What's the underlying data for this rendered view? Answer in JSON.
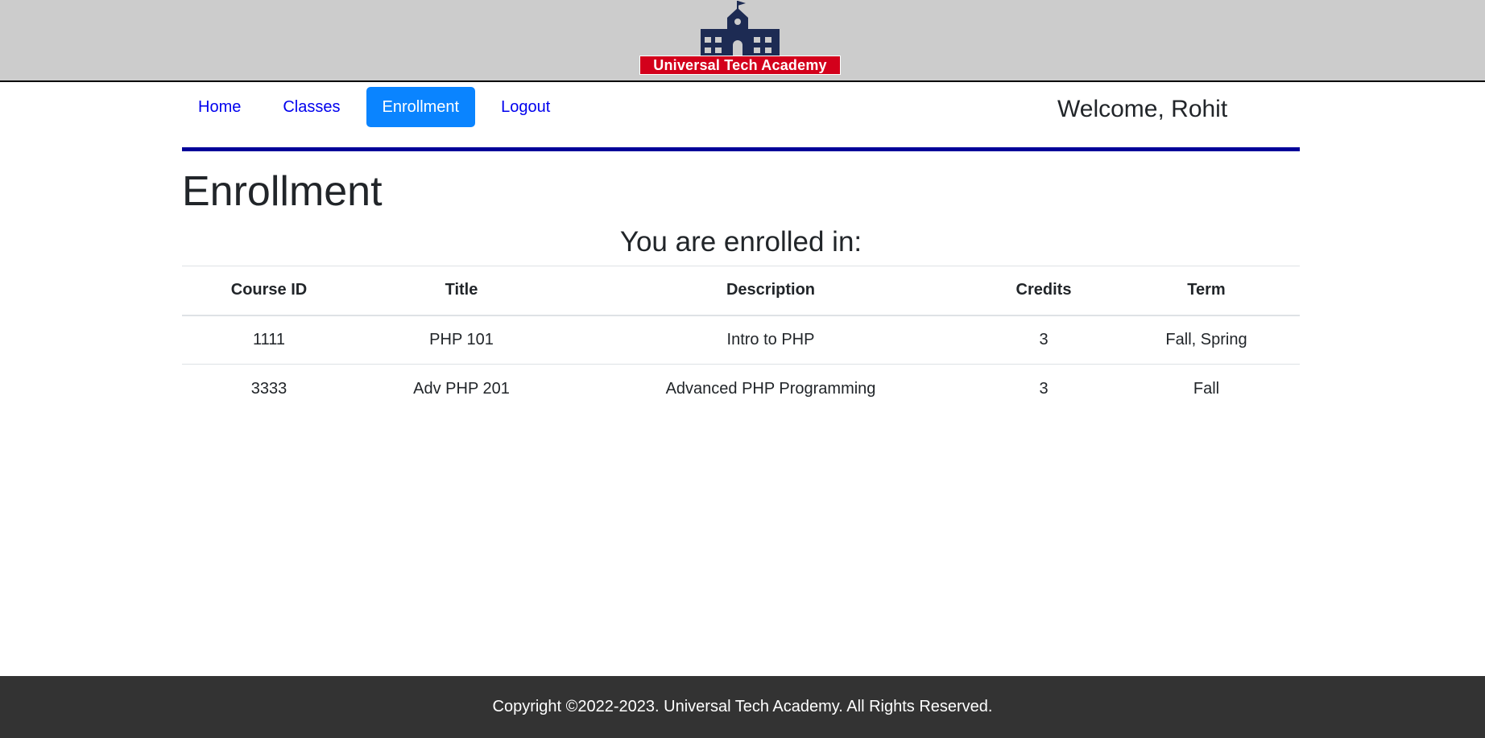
{
  "header": {
    "logo_text": "Universal Tech Academy",
    "logo_icon": "school-building-icon",
    "colors": {
      "bar": "#cccccc",
      "banner": "#d3001b",
      "building": "#1d2b53"
    }
  },
  "nav": {
    "items": [
      {
        "label": "Home",
        "active": false
      },
      {
        "label": "Classes",
        "active": false
      },
      {
        "label": "Enrollment",
        "active": true
      },
      {
        "label": "Logout",
        "active": false
      }
    ],
    "welcome": "Welcome, Rohit",
    "colors": {
      "link": "#0000ee",
      "active_bg": "#0a84ff",
      "rule": "#000099"
    }
  },
  "main": {
    "title": "Enrollment",
    "caption": "You are enrolled in:",
    "table": {
      "columns": [
        "Course ID",
        "Title",
        "Description",
        "Credits",
        "Term"
      ],
      "rows": [
        [
          "1111",
          "PHP 101",
          "Intro to PHP",
          "3",
          "Fall, Spring"
        ],
        [
          "3333",
          "Adv PHP 201",
          "Advanced PHP Programming",
          "3",
          "Fall"
        ]
      ]
    }
  },
  "footer": {
    "text": "Copyright ©2022-2023. Universal Tech Academy. All Rights Reserved.",
    "color": "#333333"
  }
}
